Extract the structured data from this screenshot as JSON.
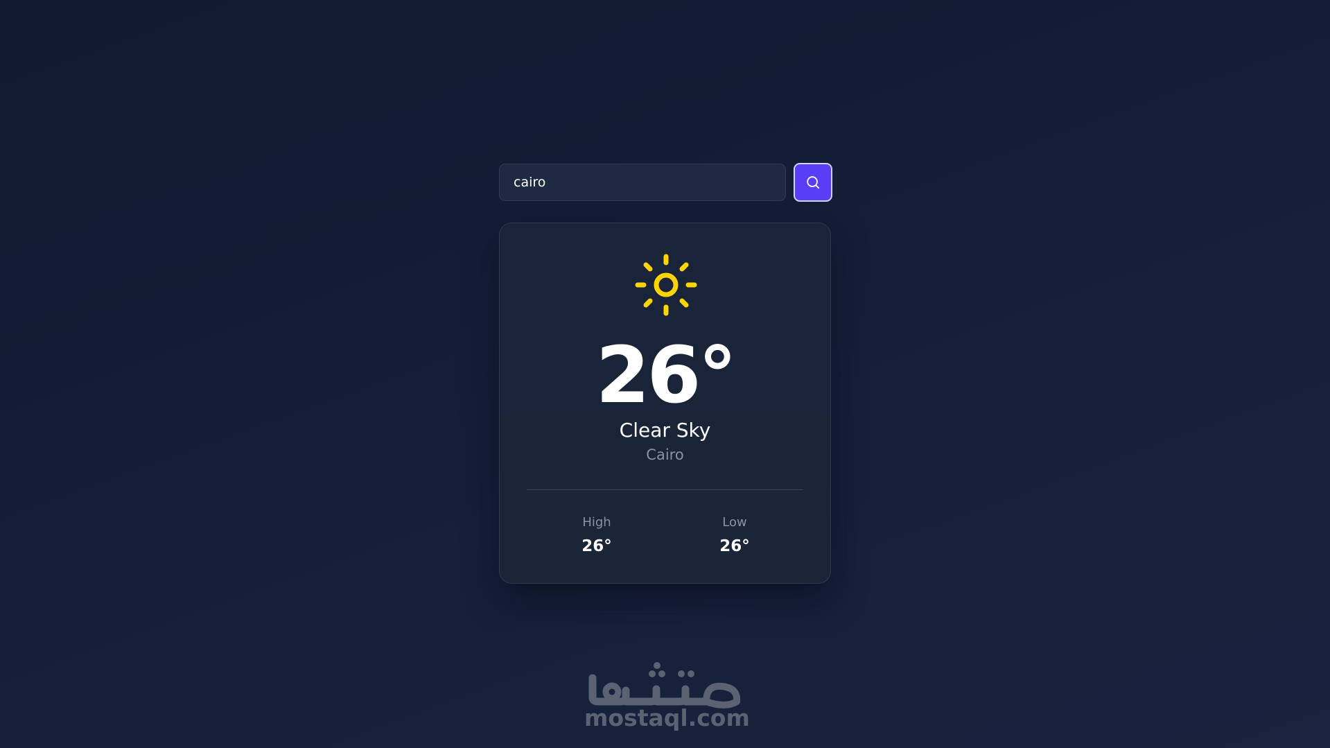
{
  "search": {
    "value": "cairo",
    "button_icon": "search-icon"
  },
  "weather": {
    "icon": "sun-icon",
    "icon_color": "#ffd400",
    "temperature": "26°",
    "condition": "Clear Sky",
    "city": "Cairo",
    "high_label": "High",
    "high_value": "26°",
    "low_label": "Low",
    "low_value": "26°"
  },
  "brand": {
    "text": "mostaql.com",
    "logo_text": "مستقل"
  },
  "colors": {
    "accent": "#5a3ef5",
    "background": "#131d33",
    "card": "#1a2439",
    "muted_text": "#8a93a6"
  }
}
